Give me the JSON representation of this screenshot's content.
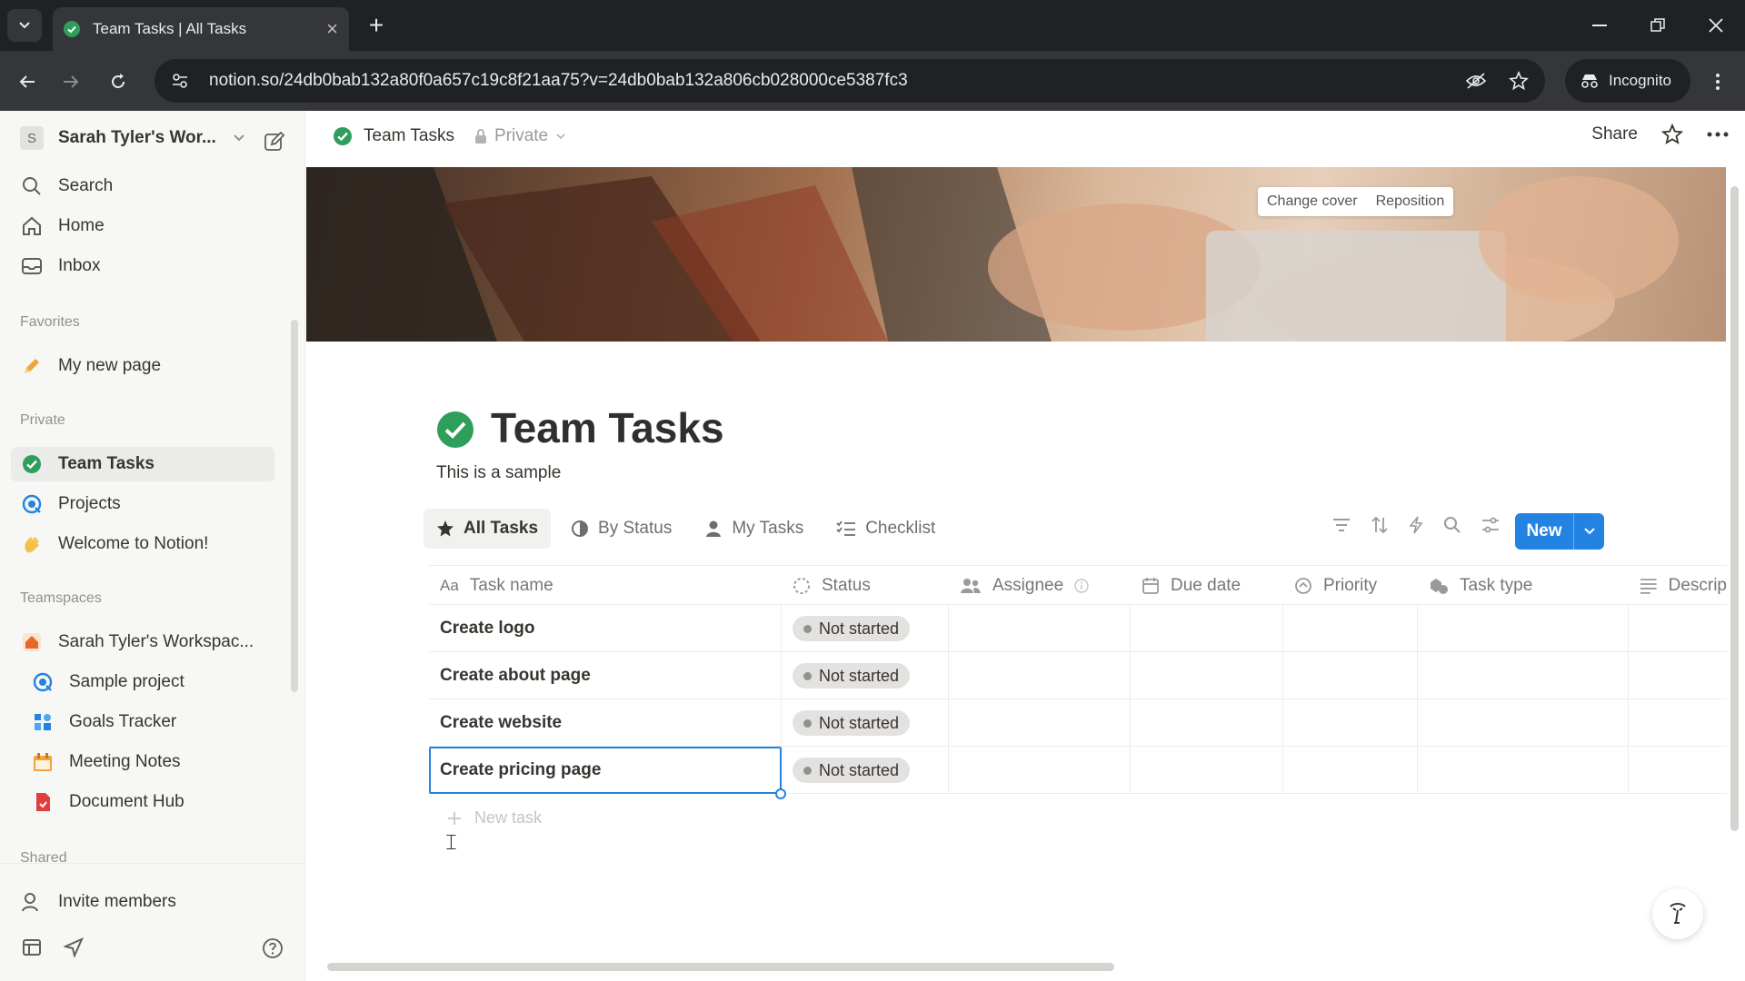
{
  "browser": {
    "tab_title": "Team Tasks | All Tasks",
    "url": "notion.so/24db0bab132a80f0a657c19c8f21aa75?v=24db0bab132a806cb028000ce5387fc3",
    "incognito_label": "Incognito"
  },
  "sidebar": {
    "workspace_initial": "S",
    "workspace_name": "Sarah Tyler's Wor...",
    "top_items": [
      {
        "label": "Search",
        "icon": "search-icon"
      },
      {
        "label": "Home",
        "icon": "home-icon"
      },
      {
        "label": "Inbox",
        "icon": "inbox-icon"
      }
    ],
    "favorites_header": "Favorites",
    "favorites": [
      {
        "label": "My new page",
        "icon": "pencil-icon"
      }
    ],
    "private_header": "Private",
    "private": [
      {
        "label": "Team Tasks",
        "icon": "check-circle-icon"
      },
      {
        "label": "Projects",
        "icon": "projects-icon"
      },
      {
        "label": "Welcome to Notion!",
        "icon": "wave-icon"
      }
    ],
    "teamspaces_header": "Teamspaces",
    "teamspace": {
      "label": "Sarah Tyler's Workspac...",
      "icon": "house-icon"
    },
    "teamspace_items": [
      {
        "label": "Sample project",
        "icon": "projects-icon"
      },
      {
        "label": "Goals Tracker",
        "icon": "goals-icon"
      },
      {
        "label": "Meeting Notes",
        "icon": "calendar-icon"
      },
      {
        "label": "Document Hub",
        "icon": "document-icon"
      }
    ],
    "shared_header": "Shared",
    "invite_label": "Invite members"
  },
  "topbar": {
    "breadcrumb_title": "Team Tasks",
    "privacy_label": "Private",
    "share_label": "Share"
  },
  "cover": {
    "change_cover_label": "Change cover",
    "reposition_label": "Reposition"
  },
  "page": {
    "title": "Team Tasks",
    "description": "This is a sample",
    "accent_color": "#2383e2",
    "icon_color": "#2f9e5b"
  },
  "views": [
    {
      "label": "All Tasks",
      "icon": "star-icon",
      "active": true
    },
    {
      "label": "By Status",
      "icon": "status-icon"
    },
    {
      "label": "My Tasks",
      "icon": "person-icon"
    },
    {
      "label": "Checklist",
      "icon": "checklist-icon"
    }
  ],
  "new_button_label": "New",
  "table": {
    "columns": [
      {
        "label": "Task name",
        "icon": "Aa"
      },
      {
        "label": "Status",
        "icon": "status-icon"
      },
      {
        "label": "Assignee",
        "icon": "people-icon"
      },
      {
        "label": "Due date",
        "icon": "calendar-icon"
      },
      {
        "label": "Priority",
        "icon": "priority-icon"
      },
      {
        "label": "Task type",
        "icon": "tasktype-icon"
      },
      {
        "label": "Descrip",
        "icon": "text-icon"
      }
    ],
    "rows": [
      {
        "name": "Create logo",
        "status": "Not started"
      },
      {
        "name": "Create about page",
        "status": "Not started"
      },
      {
        "name": "Create website",
        "status": "Not started"
      },
      {
        "name": "Create pricing page",
        "status": "Not started"
      }
    ],
    "new_row_label": "New task"
  }
}
